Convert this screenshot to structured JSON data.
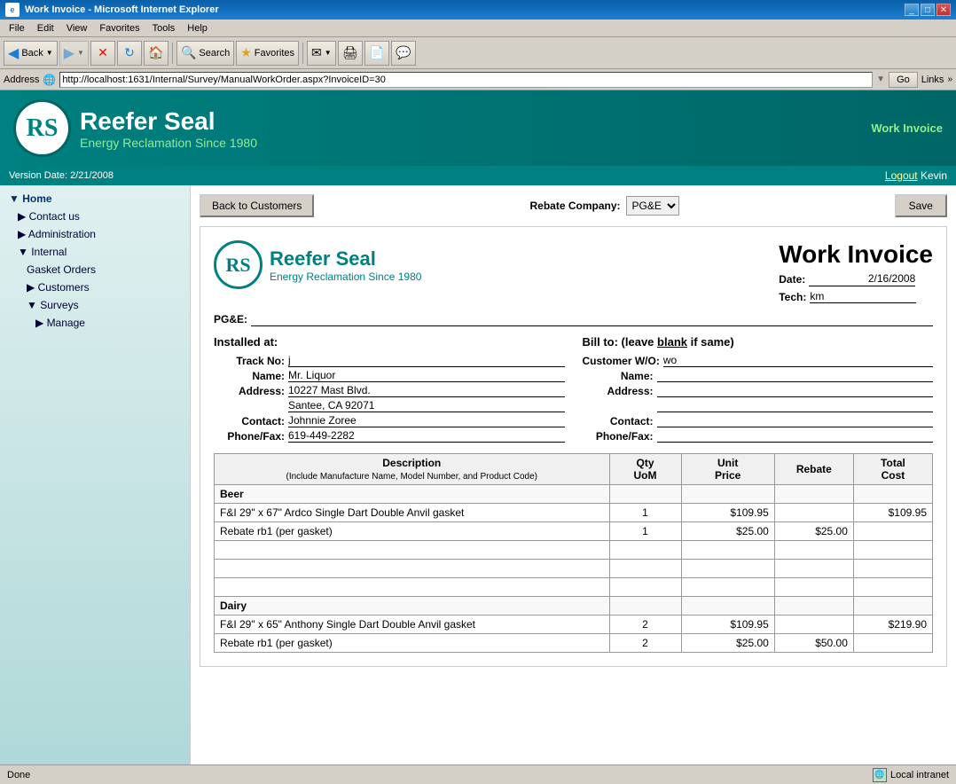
{
  "browser": {
    "title": "Work Invoice - Microsoft Internet Explorer",
    "menu": [
      "File",
      "Edit",
      "View",
      "Favorites",
      "Tools",
      "Help"
    ],
    "toolbar": {
      "back_label": "Back",
      "search_label": "Search",
      "favorites_label": "Favorites"
    },
    "address": "http://localhost:1631/Internal/Survey/ManualWorkOrder.aspx?InvoiceID=30",
    "go_label": "Go",
    "links_label": "Links"
  },
  "header": {
    "logo_text": "RS",
    "company_name": "Reefer Seal",
    "tagline": "Energy Reclamation Since 1980",
    "page_title": "Work Invoice"
  },
  "sub_header": {
    "version_date": "Version Date: 2/21/2008",
    "logout_label": "Logout",
    "user": "Kevin"
  },
  "sidebar": {
    "items": [
      {
        "label": "Home",
        "level": 0,
        "has_arrow": true
      },
      {
        "label": "Contact us",
        "level": 1,
        "has_arrow": true
      },
      {
        "label": "Administration",
        "level": 1,
        "has_arrow": true
      },
      {
        "label": "Internal",
        "level": 1,
        "has_arrow": true
      },
      {
        "label": "Gasket Orders",
        "level": 2,
        "has_arrow": false
      },
      {
        "label": "Customers",
        "level": 2,
        "has_arrow": true
      },
      {
        "label": "Surveys",
        "level": 2,
        "has_arrow": true
      },
      {
        "label": "Manage",
        "level": 3,
        "has_arrow": true
      }
    ]
  },
  "top_bar": {
    "back_button": "Back to Customers",
    "rebate_label": "Rebate Company:",
    "rebate_value": "PG&E",
    "save_label": "Save"
  },
  "invoice": {
    "logo_text": "RS",
    "company_name": "Reefer Seal",
    "tagline": "Energy Reclamation Since 1980",
    "title": "Work Invoice",
    "date_label": "Date:",
    "date_value": "2/16/2008",
    "tech_label": "Tech:",
    "tech_value": "km",
    "pge_label": "PG&E:",
    "installed_at": {
      "title": "Installed at:",
      "track_label": "Track No:",
      "track_value": "j",
      "name_label": "Name:",
      "name_value": "Mr. Liquor",
      "address_label": "Address:",
      "address_value": "10227 Mast Blvd.",
      "city_value": "Santee, CA 92071",
      "contact_label": "Contact:",
      "contact_value": "Johnnie Zoree",
      "phone_label": "Phone/Fax:",
      "phone_value": "619-449-2282"
    },
    "bill_to": {
      "title": "Bill to: (leave blank if same)",
      "wo_label": "Customer W/O:",
      "wo_value": "wo",
      "name_label": "Name:",
      "name_value": "",
      "address_label": "Address:",
      "address_value": "",
      "contact_label": "Contact:",
      "contact_value": "",
      "phone_label": "Phone/Fax:",
      "phone_value": ""
    },
    "table": {
      "headers": {
        "desc": "Description",
        "desc_sub": "(Include Manufacture Name, Model Number, and Product Code)",
        "qty": "Qty UoM",
        "unit": "Unit Price",
        "rebate": "Rebate",
        "total": "Total Cost"
      },
      "rows": [
        {
          "type": "category",
          "desc": "Beer",
          "qty": "",
          "unit": "",
          "rebate": "",
          "total": ""
        },
        {
          "type": "data",
          "desc": "F&I 29\" x 67\" Ardco Single Dart Double Anvil gasket",
          "qty": "1",
          "unit": "$109.95",
          "rebate": "",
          "total": "$109.95"
        },
        {
          "type": "data",
          "desc": "Rebate rb1 (per gasket)",
          "qty": "1",
          "unit": "$25.00",
          "rebate": "$25.00",
          "total": ""
        },
        {
          "type": "empty"
        },
        {
          "type": "empty"
        },
        {
          "type": "empty"
        },
        {
          "type": "category",
          "desc": "Dairy",
          "qty": "",
          "unit": "",
          "rebate": "",
          "total": ""
        },
        {
          "type": "data",
          "desc": "F&I 29\" x 65\" Anthony Single Dart Double Anvil gasket",
          "qty": "2",
          "unit": "$109.95",
          "rebate": "",
          "total": "$219.90"
        },
        {
          "type": "data",
          "desc": "Rebate rb1 (per gasket)",
          "qty": "2",
          "unit": "$25.00",
          "rebate": "$50.00",
          "total": ""
        }
      ]
    }
  },
  "status_bar": {
    "left": "Done",
    "right": "Local intranet"
  }
}
